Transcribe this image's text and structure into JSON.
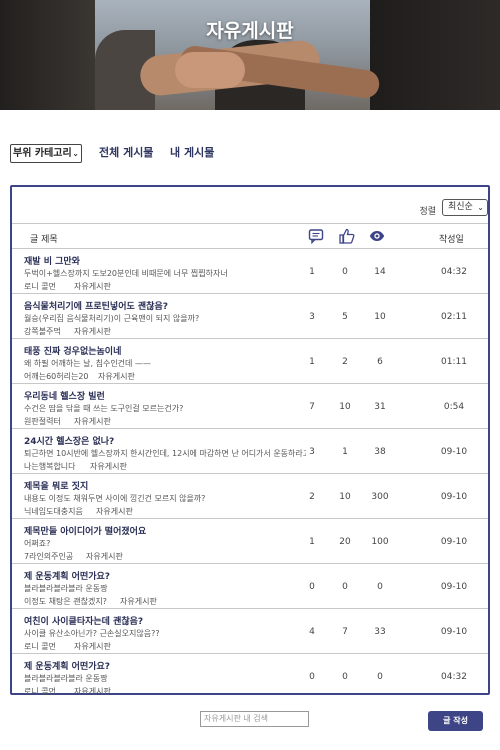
{
  "hero": {
    "title": "자유게시판"
  },
  "controls": {
    "category_select": "부위 카테고리",
    "tabs": [
      {
        "label": "전체 게시물"
      },
      {
        "label": "내 게시물"
      }
    ]
  },
  "sort": {
    "label": "정렬",
    "value": "최신순"
  },
  "table_header": {
    "title": "글 제목",
    "date": "작성일",
    "icons": [
      "comment-icon",
      "thumbs-up-icon",
      "eye-icon"
    ]
  },
  "posts": [
    {
      "title": "재발 비 그만와",
      "excerpt": "두벅이+헬스장까지 도보20분인데 비때문에 너무 찝찝하자너",
      "author": "로니 콜먼",
      "board": "자유게시판",
      "comments": "1",
      "likes": "0",
      "views": "14",
      "date": "04:32"
    },
    {
      "title": "음식물처리기에 프로틴넣어도 괜찮음?",
      "excerpt": "월승(우리집 음식물처리기)이 근육맨이 되지 않을까?",
      "author": "강쪽볼주먹",
      "board": "자유게시판",
      "comments": "3",
      "likes": "5",
      "views": "10",
      "date": "02:11"
    },
    {
      "title": "태풍 진짜 겅우없는놈이네",
      "excerpt": "왜 하필 어깨하는 날, 침수인건데 ——",
      "author": "어깨는60허리는20",
      "board": "자유게시판",
      "comments": "1",
      "likes": "2",
      "views": "6",
      "date": "01:11"
    },
    {
      "title": "우리동네 헬스장 빌런",
      "excerpt": "수건은 땀을 닦을 때 쓰는 도구인걸 모르는건가?",
      "author": "원판절력터",
      "board": "자유게시판",
      "comments": "7",
      "likes": "10",
      "views": "31",
      "date": "0:54"
    },
    {
      "title": "24시간 헬스장은 없나?",
      "excerpt": "퇴근하면 10시반에 헬스장까지 한시간인데, 12시에 마감하면 난 어디가서 운동하라고",
      "author": "나는행복합니다",
      "board": "자유게시판",
      "comments": "3",
      "likes": "1",
      "views": "38",
      "date": "09-10"
    },
    {
      "title": "제목을 뭐로 짓지",
      "excerpt": "내용도 이정도 채워두면 사이에 낑긴건 모르지 않을까?",
      "author": "닉네임도대충지음",
      "board": "자유게시판",
      "comments": "2",
      "likes": "10",
      "views": "300",
      "date": "09-10"
    },
    {
      "title": "제목만들 아이디어가 떨어졌어요",
      "excerpt": "어쩌죠?",
      "author": "7라인의주인공",
      "board": "자유게시판",
      "comments": "1",
      "likes": "20",
      "views": "100",
      "date": "09-10"
    },
    {
      "title": "제 운동계획 어떤가요?",
      "excerpt": "블라블라블라블라 운동짱",
      "author": "이정도 채탕은 괜찮겠지?",
      "board": "자유게시판",
      "comments": "0",
      "likes": "0",
      "views": "0",
      "date": "09-10"
    },
    {
      "title": "여친이 사이클타자는데 괜찮음?",
      "excerpt": "사이클 유산소아닌가? 근손실오지않음??",
      "author": "로니 콜먼",
      "board": "자유게시판",
      "comments": "4",
      "likes": "7",
      "views": "33",
      "date": "09-10"
    },
    {
      "title": "제 운동계획 어떤가요?",
      "excerpt": "블라블라블라블라 운동짱",
      "author": "로니 콜먼",
      "board": "자유게시판",
      "comments": "0",
      "likes": "0",
      "views": "0",
      "date": "04:32"
    }
  ],
  "footer": {
    "search_placeholder": "자유게시판 내 검색",
    "write_button": "글 작성"
  },
  "colors": {
    "accent": "#3d4586"
  }
}
